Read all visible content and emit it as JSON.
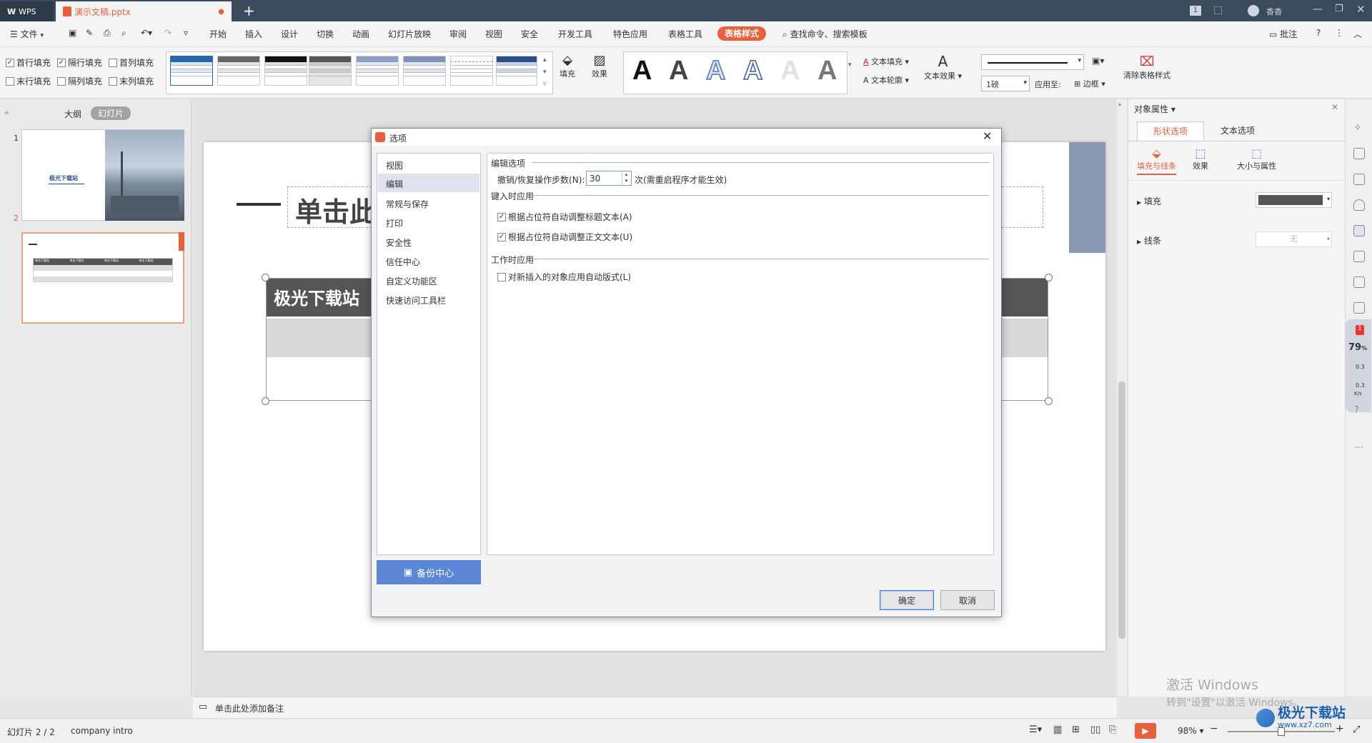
{
  "titlebar": {
    "app_tab": "WPS",
    "doc_tab": "演示文稿.pptx",
    "page_indicator": "1",
    "user": "香香"
  },
  "menu": {
    "file": "文件",
    "items": [
      "开始",
      "插入",
      "设计",
      "切换",
      "动画",
      "幻灯片放映",
      "审阅",
      "视图",
      "安全",
      "开发工具",
      "特色应用",
      "表格工具"
    ],
    "active": "表格样式",
    "search": "查找命令、搜索模板",
    "comment": "批注"
  },
  "ribbon": {
    "checks": [
      {
        "label": "首行填充",
        "checked": true
      },
      {
        "label": "隔行填充",
        "checked": true
      },
      {
        "label": "首列填充",
        "checked": false
      },
      {
        "label": "末行填充",
        "checked": false
      },
      {
        "label": "隔列填充",
        "checked": false
      },
      {
        "label": "末列填充",
        "checked": false
      }
    ],
    "fill": "填充",
    "effect": "效果",
    "text_fill": "文本填充",
    "text_outline": "文本轮廓",
    "text_effect": "文本效果",
    "line_weight": "1磅",
    "apply_to": "应用至:",
    "border": "边框",
    "clear_style": "清除表格样式",
    "big_letter": "A"
  },
  "leftpanel": {
    "tab_outline": "大纲",
    "tab_slides": "幻灯片",
    "slide1_num": "1",
    "slide1_title": "极光下载站",
    "slide2_num": "2",
    "slide2_cells": [
      "单击下载站",
      "单击下载站",
      "单击下载站",
      "单击下载站"
    ]
  },
  "slide": {
    "title_placeholder": "单击此",
    "table_header": "极光下载站"
  },
  "notes": {
    "placeholder": "单击此处添加备注"
  },
  "dialog": {
    "title": "选项",
    "nav": [
      "视图",
      "编辑",
      "常规与保存",
      "打印",
      "安全性",
      "信任中心",
      "自定义功能区",
      "快速访问工具栏"
    ],
    "nav_selected": "编辑",
    "backup": "备份中心",
    "section1": "编辑选项",
    "undo_label": "撤销/恢复操作步数(N):",
    "undo_value": "30",
    "undo_suffix": "次(需重启程序才能生效)",
    "section2": "键入时应用",
    "opt_title": "根据占位符自动调整标题文本(A)",
    "opt_body": "根据占位符自动调整正文文本(U)",
    "section3": "工作时应用",
    "opt_layout": "对新插入的对象应用自动版式(L)",
    "ok": "确定",
    "cancel": "取消"
  },
  "rightpanel": {
    "title": "对象属性",
    "tab_shape": "形状选项",
    "tab_text": "文本选项",
    "sub_fill": "填充与线条",
    "sub_effect": "效果",
    "sub_size": "大小与属性",
    "fill": "填充",
    "line": "线条",
    "line_value": "无",
    "fill_color": "#555555"
  },
  "sidebar": {
    "badge": "1",
    "percent": "79",
    "percent_unit": "%",
    "up": "0.3",
    "down": "0.3",
    "unit": "K/s"
  },
  "status": {
    "slide": "幻灯片 2 / 2",
    "theme": "company intro",
    "zoom": "98%",
    "activate1": "激活 Windows",
    "activate2": "转到\"设置\"以激活 Windows。",
    "watermark": "极光下载站",
    "watermark_url": "www.xz7.com"
  },
  "colors": {
    "accent": "#e8603c",
    "title": "#3b4a5c",
    "dialog_nav_sel": "#dde4ee",
    "backup": "#5b87d6"
  }
}
